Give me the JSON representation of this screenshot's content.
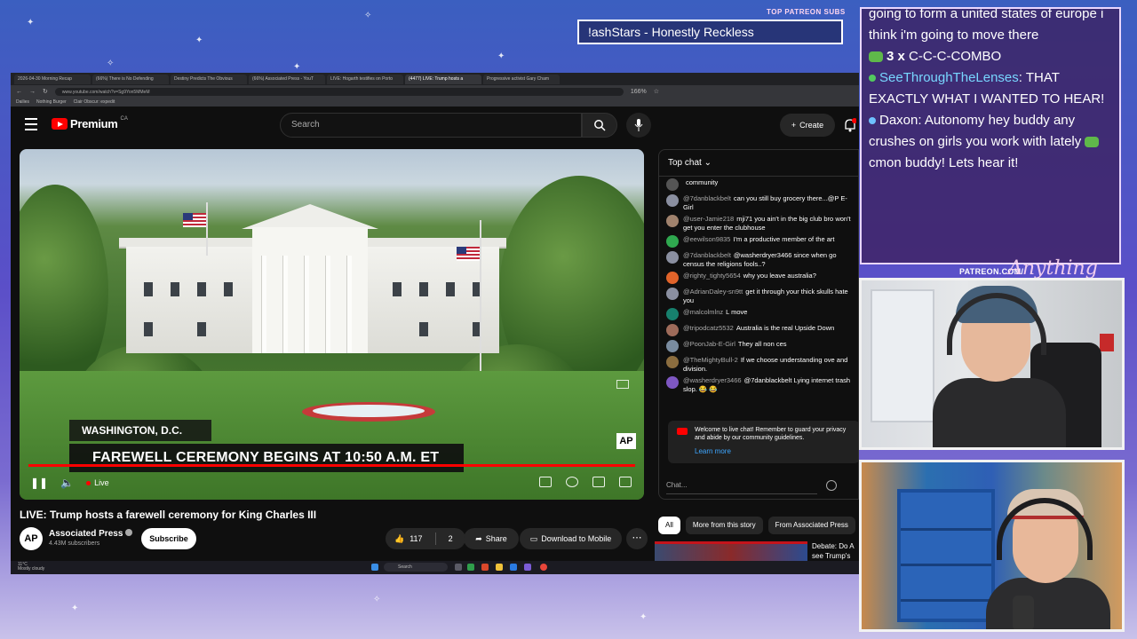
{
  "overlay": {
    "patreon_subs_label": "TOP PATREON SUBS",
    "patreon_sub_name": "!ashStars - Honestly Reckless",
    "patreon_url": "PATREON.COM/",
    "chat": [
      {
        "type": "text",
        "text": "going to form a united states of europe i think i'm going to move there"
      },
      {
        "type": "combo",
        "count": "3 x",
        "text": "C-C-C-COMBO"
      },
      {
        "type": "message",
        "author": "SeeThroughTheLenses",
        "text": "THAT EXACTLY WHAT I WANTED TO HEAR!"
      },
      {
        "type": "message",
        "author": "Daxon",
        "text": "Autonomy hey buddy any crushes on girls you work with lately",
        "text2": "cmon buddy! Lets hear it!"
      }
    ]
  },
  "browser": {
    "tabs": [
      "2026-04-30 Morning Recap",
      "(66%) There is No Defending",
      "Destiny Predicts The Obvious",
      "(66%) Associated Press - YouT",
      "LIVE: Hogarth testifies on Porto",
      "(4477) LIVE: Trump hosts a",
      "Progressive activist Gary Cham"
    ],
    "active_tab": 5,
    "url": "www.youtube.com/watch?v=Sg9Yon5MMeM",
    "zoom": "166%",
    "bookmarks": [
      "Dailies",
      "Nothing Burger",
      "Clair Obscur: expedit"
    ]
  },
  "youtube": {
    "logo_text": "Premium",
    "country": "CA",
    "search_placeholder": "Search",
    "create_label": "Create",
    "video": {
      "location": "WASHINGTON, D.C.",
      "headline": "FAREWELL CEREMONY BEGINS AT 10:50 A.M. ET",
      "ap_logo": "AP",
      "live_label": "Live"
    },
    "title": "LIVE: Trump hosts a farewell ceremony for King Charles III",
    "channel": {
      "avatar_text": "AP",
      "name": "Associated Press",
      "subscribers": "4.43M subscribers",
      "subscribe_label": "Subscribe"
    },
    "likes": "117",
    "dislike_count": "2",
    "share_label": "Share",
    "download_label": "Download to Mobile",
    "chips": [
      "All",
      "More from this story",
      "From Associated Press"
    ],
    "recommendation_title": "Debate: Do A see Trump's"
  },
  "live_chat": {
    "header": "Top chat",
    "messages": [
      {
        "author": "",
        "text": "community",
        "color": "#555555"
      },
      {
        "author": "@7danblackbelt",
        "text": "can you still buy grocery there...@P E-Girl",
        "color": "#8a8fa0"
      },
      {
        "author": "@user-Jamie218",
        "text": "mji71 you ain't in the big club bro won't get you enter the clubhouse",
        "color": "#a0826d"
      },
      {
        "author": "@eewilson9835",
        "text": "I'm a productive member of the art",
        "color": "#2fa84f"
      },
      {
        "author": "@7danblackbelt",
        "text": "@washerdryer3466 since when go census the religions fools..?",
        "color": "#8a8fa0"
      },
      {
        "author": "@righty_tighty5654",
        "text": "why you leave australia?",
        "color": "#e0632a"
      },
      {
        "author": "@AdrianDaley-sn9tt",
        "text": "get it through your thick skulls hate you",
        "color": "#8a8fa0"
      },
      {
        "author": "@malcolmlnz",
        "text": "L move",
        "color": "#17806d"
      },
      {
        "author": "@tripodcatz5532",
        "text": "Australia is the real Upside Down",
        "color": "#9e6b5a"
      },
      {
        "author": "@PoonJab-E-Girl",
        "text": "They all non ces",
        "color": "#7a8ca0"
      },
      {
        "author": "@TheMightyBull-2",
        "text": "If we choose understanding ove and division.",
        "color": "#8b6d3f"
      },
      {
        "author": "@washerdryer3466",
        "text": "@7danblackbelt Lying internet trash slop. 😂 😂",
        "color": "#7e57c2"
      }
    ],
    "notice": "Welcome to live chat! Remember to guard your privacy and abide by our community guidelines.",
    "learn_more": "Learn more",
    "input_placeholder": "Chat..."
  },
  "taskbar": {
    "weather_temp": "11°C",
    "weather_desc": "Mostly cloudy",
    "search_placeholder": "Search"
  },
  "colors": {
    "accent": "#ff0000",
    "overlay_border": "#e9d6ff",
    "link": "#3ea6ff"
  }
}
